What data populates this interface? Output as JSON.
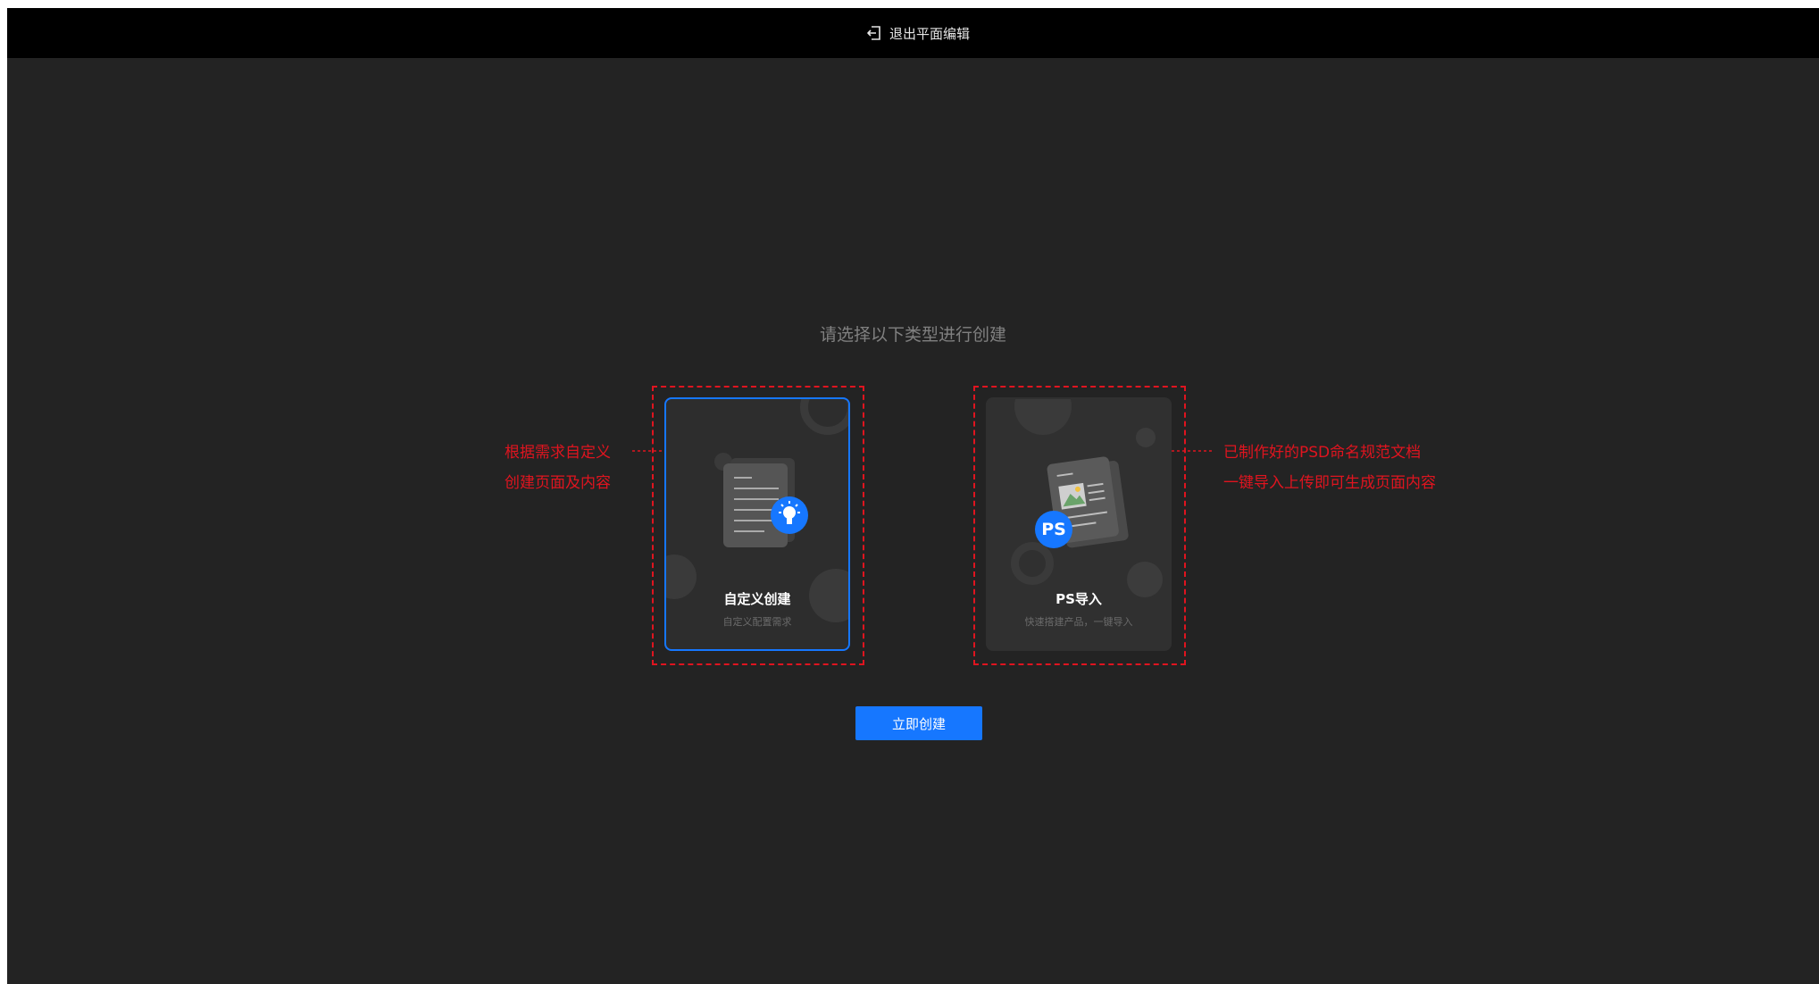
{
  "topbar": {
    "exit_label": "退出平面编辑",
    "exit_icon": "exit-icon"
  },
  "main": {
    "prompt": "请选择以下类型进行创建",
    "cards": [
      {
        "title": "自定义创建",
        "subtitle": "自定义配置需求",
        "icon": "document-lightbulb-icon",
        "selected": true
      },
      {
        "title": "PS导入",
        "subtitle": "快速搭建产品，一键导入",
        "icon": "ps-document-icon",
        "badge": "PS",
        "selected": false
      }
    ],
    "create_button": "立即创建"
  },
  "annotations": {
    "left": [
      "根据需求自定义",
      "创建页面及内容"
    ],
    "right": [
      "已制作好的PSD命名规范文档",
      "一键导入上传即可生成页面内容"
    ]
  },
  "colors": {
    "accent": "#1677ff",
    "annotation": "#e0141f",
    "background": "#232323",
    "topbar": "#000000"
  }
}
